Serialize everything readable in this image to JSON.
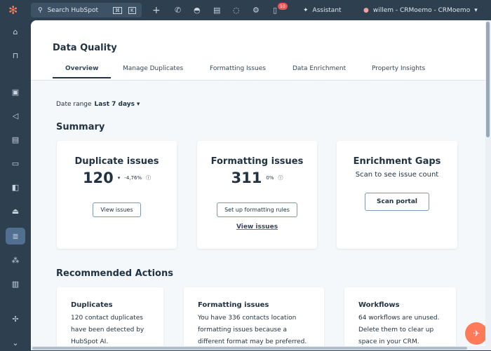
{
  "topbar": {
    "search_placeholder": "Search HubSpot",
    "kbd1": "⌘",
    "kbd2": "K",
    "notification_count": "10",
    "assistant": "Assistant",
    "account": "willem - CRMoemo - CRMoemo"
  },
  "page": {
    "title": "Data Quality",
    "tabs": [
      "Overview",
      "Manage Duplicates",
      "Formatting Issues",
      "Data Enrichment",
      "Property Insights"
    ],
    "date_range_label": "Date range",
    "date_range_value": "Last 7 days"
  },
  "summary": {
    "heading": "Summary",
    "duplicates": {
      "title": "Duplicate issues",
      "value": "120",
      "change": "-4,76%",
      "button": "View issues"
    },
    "formatting": {
      "title": "Formatting issues",
      "value": "311",
      "change": "0%",
      "button": "Set up formatting rules",
      "link": "View issues"
    },
    "enrichment": {
      "title": "Enrichment Gaps",
      "subtitle": "Scan to see issue count",
      "button": "Scan portal"
    }
  },
  "recommended": {
    "heading": "Recommended Actions",
    "cards": [
      {
        "title": "Duplicates",
        "text": "120 contact duplicates have been detected by HubSpot AI."
      },
      {
        "title": "Formatting issues",
        "text": "You have 336 contacts location formatting issues because a different format may be preferred."
      },
      {
        "title": "Workflows",
        "text": "64 workflows are unused. Delete them to clear up space in your CRM."
      }
    ]
  }
}
